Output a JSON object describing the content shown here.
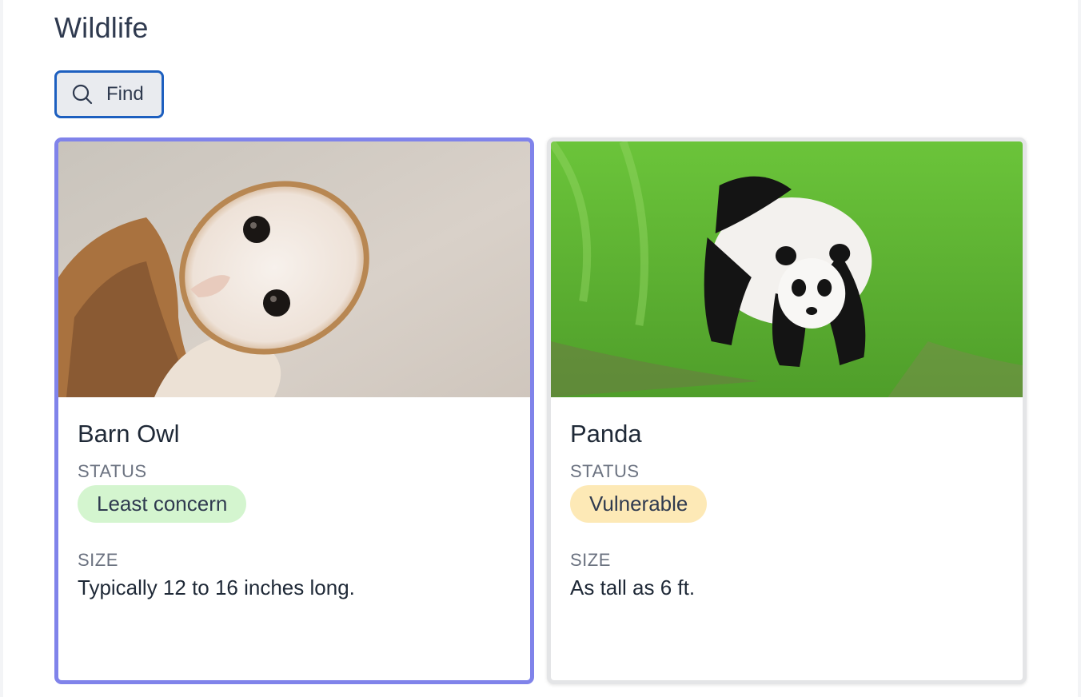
{
  "header": {
    "title": "Wildlife"
  },
  "toolbar": {
    "find_label": "Find",
    "find_icon": "search-icon"
  },
  "colors": {
    "selected_border": "#8083ea",
    "find_border": "#1d5fbf",
    "badge_least_concern": "#d4f5cf",
    "badge_vulnerable": "#fde9b6"
  },
  "cards": [
    {
      "name": "Barn Owl",
      "status_label": "STATUS",
      "status": "Least concern",
      "size_label": "SIZE",
      "size": "Typically 12 to 16 inches long.",
      "selected": true
    },
    {
      "name": "Panda",
      "status_label": "STATUS",
      "status": "Vulnerable",
      "size_label": "SIZE",
      "size": "As tall as 6 ft.",
      "selected": false
    }
  ]
}
